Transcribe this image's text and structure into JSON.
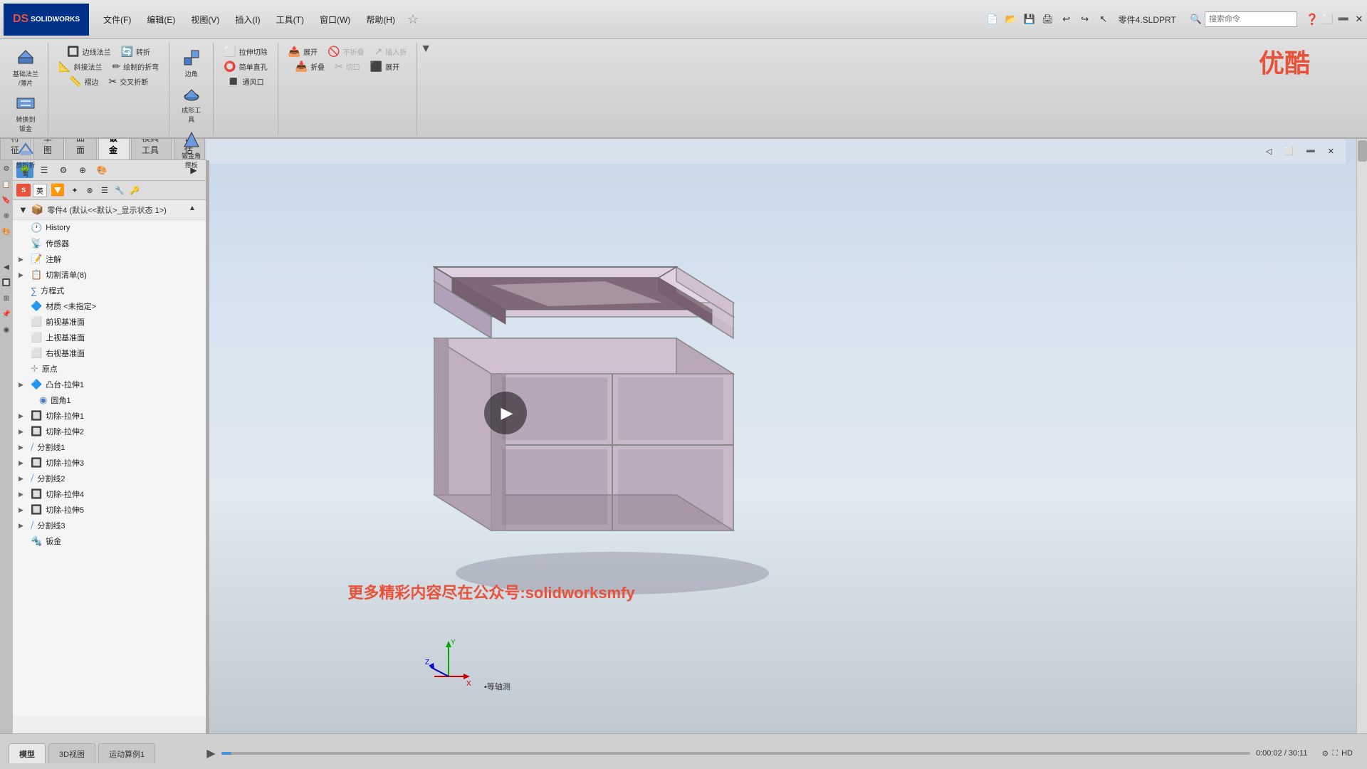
{
  "app": {
    "title": "SOLIDWORKS",
    "part_file": "零件4.SLDPRT",
    "window_title": "零件4 (默认<<默认>_显示状态 1>) *"
  },
  "topbar": {
    "logo": "DS SOLIDWORKS",
    "menus": [
      "文件(F)",
      "编辑(E)",
      "视图(V)",
      "插入(I)",
      "工具(T)",
      "窗口(W)",
      "帮助(H)"
    ]
  },
  "toolbar": {
    "groups": [
      {
        "name": "基础法兰-薄片",
        "btns": [
          "基础法兰/薄片",
          "转换到钣金",
          "放折折弯"
        ]
      },
      {
        "name": "边线法兰",
        "btns": [
          "边线法兰",
          "斜接法兰",
          "褶边",
          "转折",
          "绘制的折弯",
          "交叉折断"
        ]
      },
      {
        "name": "成形工具",
        "btns": [
          "边角",
          "成形工具",
          "钣金角撑板"
        ]
      },
      {
        "name": "拉伸切除",
        "btns": [
          "拉伸切除",
          "简单直孔",
          "通风口"
        ]
      },
      {
        "name": "展开",
        "btns": [
          "展开",
          "折叠",
          "不折叠",
          "切口",
          "插入折",
          "展开"
        ]
      }
    ]
  },
  "feature_tabs": [
    "特征",
    "草图",
    "曲面",
    "钣金",
    "模具工具",
    "评估"
  ],
  "active_tab": "钣金",
  "view_toolbar": {
    "icons": [
      "magnify",
      "magnify2",
      "sketch",
      "cube",
      "shape",
      "display",
      "color-wheel",
      "gear",
      "monitor"
    ]
  },
  "part_tree": {
    "root": "零件4 (默认<<默认>_显示状态 1>)",
    "items": [
      {
        "id": "history",
        "label": "History",
        "level": 1,
        "icon": "clock",
        "expandable": false
      },
      {
        "id": "sensor",
        "label": "传感器",
        "level": 1,
        "icon": "sensor",
        "expandable": false
      },
      {
        "id": "annotation",
        "label": "注解",
        "level": 1,
        "icon": "annotation",
        "expandable": true
      },
      {
        "id": "cutlist",
        "label": "切割清单(8)",
        "level": 1,
        "icon": "cutlist",
        "expandable": true
      },
      {
        "id": "equations",
        "label": "方程式",
        "level": 1,
        "icon": "equations",
        "expandable": false
      },
      {
        "id": "material",
        "label": "材质 <未指定>",
        "level": 1,
        "icon": "material",
        "expandable": false
      },
      {
        "id": "front-plane",
        "label": "前视基准面",
        "level": 1,
        "icon": "plane",
        "expandable": false
      },
      {
        "id": "top-plane",
        "label": "上视基准面",
        "level": 1,
        "icon": "plane",
        "expandable": false
      },
      {
        "id": "right-plane",
        "label": "右视基准面",
        "level": 1,
        "icon": "plane",
        "expandable": false
      },
      {
        "id": "origin",
        "label": "原点",
        "level": 1,
        "icon": "origin",
        "expandable": false
      },
      {
        "id": "boss-extrude1",
        "label": "凸台-拉伸1",
        "level": 1,
        "icon": "extrude",
        "expandable": true
      },
      {
        "id": "fillet1",
        "label": "圆角1",
        "level": 2,
        "icon": "fillet",
        "expandable": false
      },
      {
        "id": "cut-extrude1",
        "label": "切除-拉伸1",
        "level": 1,
        "icon": "cut",
        "expandable": true
      },
      {
        "id": "cut-extrude2",
        "label": "切除-拉伸2",
        "level": 1,
        "icon": "cut",
        "expandable": true
      },
      {
        "id": "split1",
        "label": "分割线1",
        "level": 1,
        "icon": "split",
        "expandable": true
      },
      {
        "id": "cut-extrude3",
        "label": "切除-拉伸3",
        "level": 1,
        "icon": "cut",
        "expandable": true
      },
      {
        "id": "split2",
        "label": "分割线2",
        "level": 1,
        "icon": "split",
        "expandable": true
      },
      {
        "id": "cut-extrude4",
        "label": "切除-拉伸4",
        "level": 1,
        "icon": "cut",
        "expandable": true
      },
      {
        "id": "cut-extrude5",
        "label": "切除-拉伸5",
        "level": 1,
        "icon": "cut",
        "expandable": true
      },
      {
        "id": "split3",
        "label": "分割线3",
        "level": 1,
        "icon": "split",
        "expandable": true
      },
      {
        "id": "sheetmetal",
        "label": "钣金",
        "level": 1,
        "icon": "sheetmetal",
        "expandable": false
      }
    ]
  },
  "bottom_tabs": [
    "模型",
    "3D视图",
    "运动算例1"
  ],
  "active_bottom_tab": "模型",
  "view_label": "•等轴测",
  "time": {
    "current": "0:00:02",
    "total": "30:11"
  },
  "watermark": "更多精彩内容尽在公众号:solidworksmfy",
  "youku": "优酷",
  "search_placeholder": "搜索命令"
}
